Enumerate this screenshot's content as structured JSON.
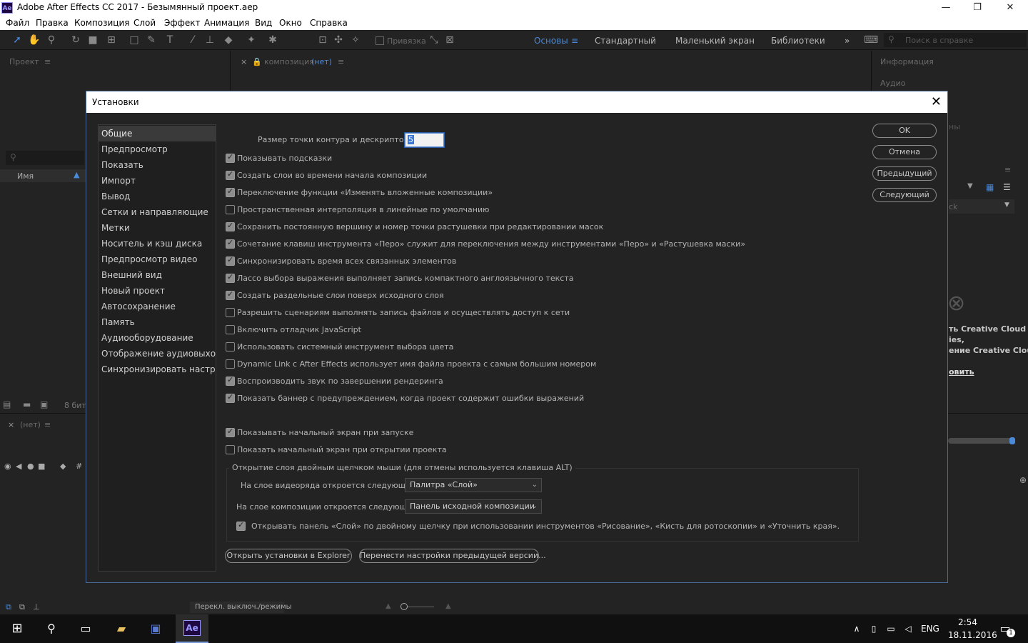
{
  "window": {
    "title": "Adobe After Effects CC 2017 - Безымянный проект.aep",
    "logo": "Ae"
  },
  "menu": [
    "Файл",
    "Правка",
    "Композиция",
    "Слой",
    "Эффект",
    "Анимация",
    "Вид",
    "Окно",
    "Справка"
  ],
  "toolbar": {
    "snap_label": "Привязка",
    "workspaces": [
      "Основы",
      "Стандартный",
      "Маленький экран",
      "Библиотеки"
    ],
    "search_placeholder": "Поиск в справке"
  },
  "panels": {
    "project": "Проект",
    "comp_tab": "композиция",
    "comp_none": "(нет)",
    "info": "Информация",
    "audio": "Аудио",
    "name_col": "Имя",
    "bitdepth": "8 бит",
    "timeline_none": "(нет)",
    "switches": "Перекл. выключ./режимы",
    "cc_line1": "ть Creative Cloud",
    "cc_line2": "ies,",
    "cc_line3": "ение Creative Cloud",
    "cc_link": "овить",
    "lib_right": "ck",
    "info_ri": "ны"
  },
  "dialog": {
    "title": "Установки",
    "categories": [
      "Общие",
      "Предпросмотр",
      "Показать",
      "Импорт",
      "Вывод",
      "Сетки и направляющие",
      "Метки",
      "Носитель и кэш диска",
      "Предпросмотр видео",
      "Внешний вид",
      "Новый проект",
      "Автосохранение",
      "Память",
      "Аудиооборудование",
      "Отображение аудиовыхода",
      "Синхронизировать настройки"
    ],
    "selected_category": "Общие",
    "path_point_label": "Размер точки контура и дескриптора:",
    "path_point_value": "5",
    "options": [
      {
        "label": "Показывать подсказки",
        "checked": true
      },
      {
        "label": "Создать слои во времени начала композиции",
        "checked": true
      },
      {
        "label": "Переключение функции «Изменять вложенные композиции»",
        "checked": true
      },
      {
        "label": "Пространственная интерполяция в линейные по умолчанию",
        "checked": false
      },
      {
        "label": "Сохранить постоянную вершину и номер точки растушевки при редактировании масок",
        "checked": true
      },
      {
        "label": "Сочетание клавиш инструмента «Перо» служит для переключения между инструментами «Перо» и «Растушевка маски»",
        "checked": true
      },
      {
        "label": "Синхронизировать время всех связанных элементов",
        "checked": true
      },
      {
        "label": "Лассо выбора выражения выполняет запись компактного англоязычного текста",
        "checked": true
      },
      {
        "label": "Создать раздельные слои поверх исходного слоя",
        "checked": true
      },
      {
        "label": "Разрешить сценариям выполнять запись файлов и осуществлять доступ к сети",
        "checked": false
      },
      {
        "label": "Включить отладчик JavaScript",
        "checked": false
      },
      {
        "label": "Использовать системный инструмент выбора цвета",
        "checked": false
      },
      {
        "label": "Dynamic Link с After Effects использует имя файла проекта с самым большим номером",
        "checked": false
      },
      {
        "label": "Воспроизводить звук по завершении рендеринга",
        "checked": true
      },
      {
        "label": "Показать баннер с предупреждением, когда проект содержит ошибки выражений",
        "checked": true
      }
    ],
    "startup_options": [
      {
        "label": "Показывать начальный экран при запуске",
        "checked": true
      },
      {
        "label": "Показать начальный экран при открытии проекта",
        "checked": false
      }
    ],
    "dblclick_group": "Открытие слоя двойным щелчком мыши (для отмены используется клавиша ALT)",
    "footage_label": "На слое видеоряда откроется следующее:",
    "footage_value": "Палитра «Слой»",
    "comp_label": "На слое композиции откроется следующее:",
    "comp_value": "Панель исходной композиции",
    "paint_option": {
      "label": "Открывать панель «Слой» по двойному щелчку при использовании инструментов «Рисование», «Кисть для ротоскопии» и «Уточнить края».",
      "checked": true
    },
    "btn_explorer": "Открыть установки в Explorer",
    "btn_migrate": "Перенести настройки предыдущей версии...",
    "btn_ok": "OK",
    "btn_cancel": "Отмена",
    "btn_prev": "Предыдущий",
    "btn_next": "Следующий"
  },
  "taskbar": {
    "lang": "ENG",
    "time": "2:54",
    "date": "18.11.2016",
    "notif_count": "1",
    "ae_label": "Ae"
  }
}
